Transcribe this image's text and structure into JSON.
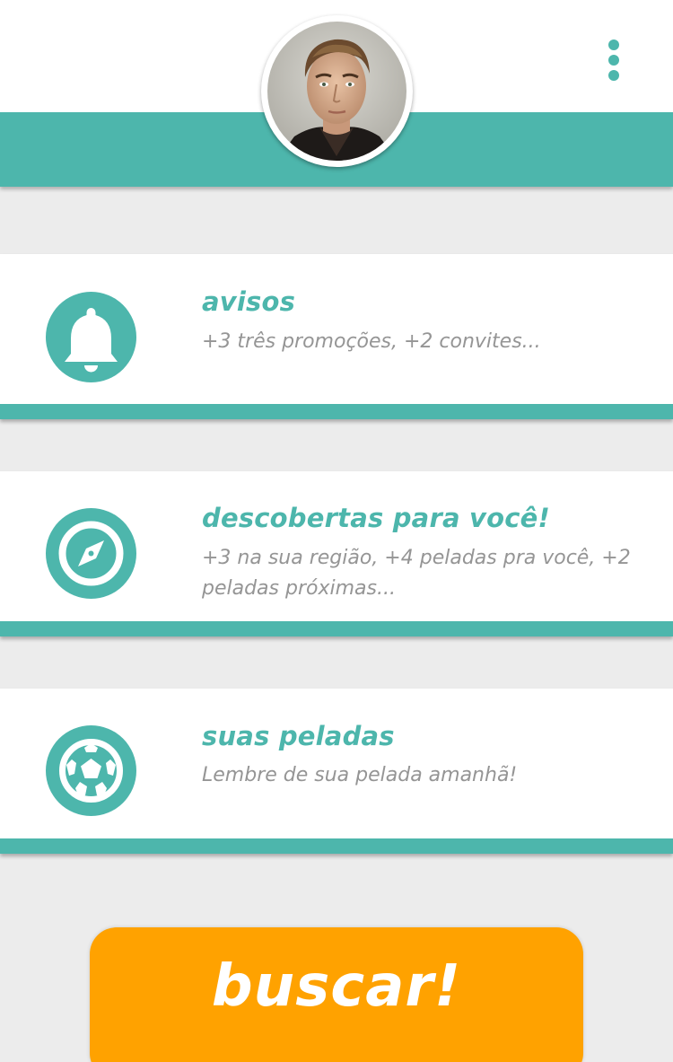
{
  "header": {
    "avatar_alt": "profile photo",
    "menu_icon": "more-vert-icon"
  },
  "cards": [
    {
      "icon": "bell-icon",
      "title": "avisos",
      "description": "+3 três promoções, +2 convites..."
    },
    {
      "icon": "compass-icon",
      "title": "descobertas para você!",
      "description": "+3 na sua região, +4 peladas pra você, +2 peladas próximas..."
    },
    {
      "icon": "soccer-ball-icon",
      "title": "suas peladas",
      "description": "Lembre de sua pelada amanhã!"
    }
  ],
  "search_button": {
    "label": "buscar!"
  },
  "colors": {
    "primary": "#4db6ac",
    "accent": "#ffa200",
    "background": "#ececec",
    "text_muted": "#959595"
  }
}
